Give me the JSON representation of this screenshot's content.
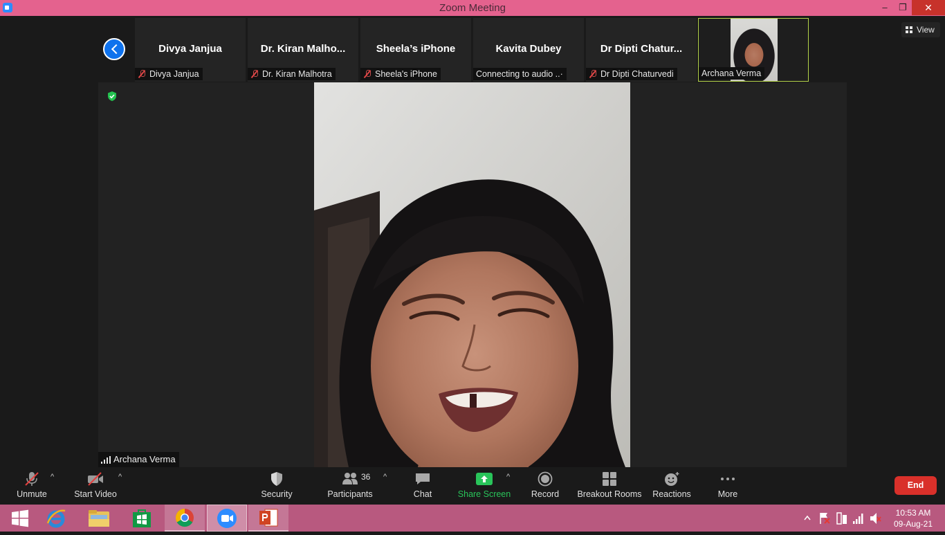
{
  "window": {
    "title": "Zoom Meeting",
    "minimize_glyph": "–",
    "maximize_glyph": "❐",
    "close_glyph": "✕"
  },
  "meeting": {
    "view_label": "View",
    "participants_strip": [
      {
        "display_name": "Divya Janjua",
        "label": "Divya Janjua",
        "muted": true
      },
      {
        "display_name": "Dr.  Kiran Malho...",
        "label": "Dr.  Kiran Malhotra",
        "muted": true
      },
      {
        "display_name": "Sheela’s iPhone",
        "label": "Sheela's iPhone",
        "muted": true
      },
      {
        "display_name": "Kavita Dubey",
        "label": "Connecting to audio ..·",
        "muted": false
      },
      {
        "display_name": "Dr  Dipti  Chatur...",
        "label": "Dr Dipti Chaturvedi",
        "muted": true
      },
      {
        "display_name": "",
        "label": "Archana Verma",
        "muted": false,
        "active_speaker": true
      }
    ],
    "main_speaker_label": "Archana Verma"
  },
  "toolbar": {
    "unmute_label": "Unmute",
    "start_video_label": "Start Video",
    "security_label": "Security",
    "participants_label": "Participants",
    "participants_count": "36",
    "chat_label": "Chat",
    "share_screen_label": "Share Screen",
    "record_label": "Record",
    "breakout_rooms_label": "Breakout Rooms",
    "reactions_label": "Reactions",
    "more_label": "More",
    "end_label": "End"
  },
  "colors": {
    "titlebar": "#e4628e",
    "taskbar": "#b8597f",
    "end_button": "#d9302a",
    "share_green": "#29c45a",
    "active_speaker_border": "#b4d44a",
    "back_button": "#0e72ed"
  },
  "icons": {
    "unmute": "mic-off-icon",
    "start_video": "video-off-icon",
    "security": "shield-icon",
    "participants": "people-icon",
    "chat": "chat-bubble-icon",
    "share": "share-arrow-icon",
    "record": "record-icon",
    "breakout": "grid-icon",
    "reactions": "smiley-plus-icon",
    "more": "ellipsis-icon"
  },
  "taskbar": {
    "time": "10:53 AM",
    "date": "09-Aug-21"
  }
}
